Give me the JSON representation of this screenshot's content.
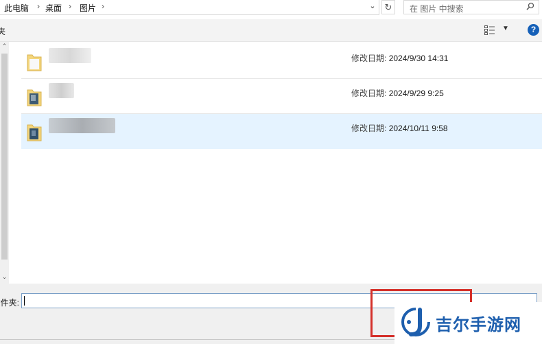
{
  "address_bar": {
    "breadcrumbs": [
      "此电脑",
      "桌面",
      "图片"
    ]
  },
  "search": {
    "placeholder": "在 图片 中搜索"
  },
  "toolbar": {
    "partial_label": "新建文件夹"
  },
  "files": [
    {
      "modified_label": "修改日期:",
      "modified_value": "2024/9/30 14:31",
      "selected": false
    },
    {
      "modified_label": "修改日期:",
      "modified_value": "2024/9/29 9:25",
      "selected": false
    },
    {
      "modified_label": "修改日期:",
      "modified_value": "2024/10/11 9:58",
      "selected": true
    }
  ],
  "filename_bar": {
    "label": "文件夹:",
    "value": ""
  },
  "watermark": {
    "text": "吉尔手游网"
  },
  "colors": {
    "accent": "#1560b8",
    "selection": "#e5f3ff",
    "highlight": "#d4302a",
    "watermark": "#1e5fae"
  }
}
